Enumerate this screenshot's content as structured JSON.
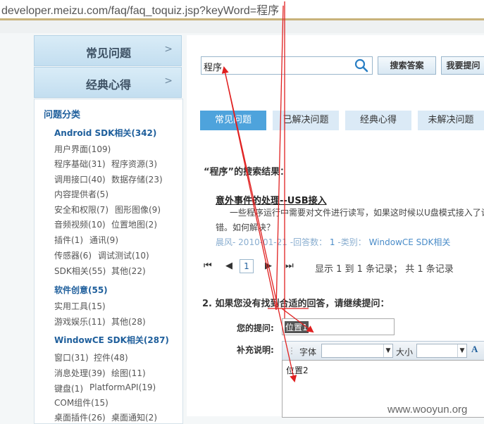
{
  "browser": {
    "url": "developer.meizu.com/faq/faq_toquiz.jsp?keyWord=程序"
  },
  "sidebar": {
    "nav": [
      {
        "label": "常见问题"
      },
      {
        "label": "经典心得"
      }
    ],
    "category_title": "问题分类",
    "groups": [
      {
        "title": "Android SDK相关(342)",
        "items": [
          "用户界面(109)",
          "程序基础(31)",
          "程序资源(3)",
          "调用接口(40)",
          "数据存储(23)",
          "内容提供者(5)",
          "安全和权限(7)",
          "图形图像(9)",
          "音频视频(10)",
          "位置地图(2)",
          "插件(1)",
          "通讯(9)",
          "传感器(6)",
          "调试测试(10)",
          "SDK相关(55)",
          "其他(22)"
        ]
      },
      {
        "title": "软件创意(55)",
        "items": [
          "实用工具(15)",
          "游戏娱乐(11)",
          "其他(28)"
        ]
      },
      {
        "title": "WindowCE SDK相关(287)",
        "items": [
          "窗口(31)",
          "控件(48)",
          "消息处理(39)",
          "绘图(11)",
          "键盘(1)",
          "PlatformAPI(19)",
          "COM组件(15)",
          "桌面插件(26)",
          "桌面通知(2)"
        ]
      }
    ]
  },
  "search": {
    "value": "程序",
    "search_btn": "搜索答案",
    "ask_btn": "我要提问"
  },
  "tabs": [
    {
      "label": "常见问题"
    },
    {
      "label": "已解决问题"
    },
    {
      "label": "经典心得"
    },
    {
      "label": "未解决问题"
    }
  ],
  "results": {
    "header": "“程序”的搜索结果：",
    "items": [
      {
        "title": "意外事件的处理--USB接入",
        "desc_line1": "一些程序运行中需要对文件进行读写，如果这时候以U盘模式接入了计",
        "desc_line2": "错。如何解决？",
        "author": "晨风",
        "date": "2010-01-21",
        "answers_label": "-回答数：",
        "answers": "1",
        "category_label": "-类别：",
        "category": "WindowCE SDK相关"
      }
    ]
  },
  "pager": {
    "first": "⏮",
    "prev": "◀",
    "current": "1",
    "next": "▶",
    "last": "⏭",
    "info": "显示 1 到 1 条记录； 共 1 条记录"
  },
  "ask": {
    "header": "2. 如果您没有找到合适的回答，请继续提问：",
    "question_label": "您的提问:",
    "question_value": "位置1",
    "supplement_label": "补充说明:",
    "toolbar": {
      "font_label": "字体",
      "size_label": "大小",
      "font_color_icon": "A"
    },
    "editor_value": "位置2"
  },
  "watermark": "www.wooyun.org",
  "colors": {
    "accent": "#4ea3dc",
    "annotation": "#e02020",
    "link": "#1f5f9c"
  }
}
